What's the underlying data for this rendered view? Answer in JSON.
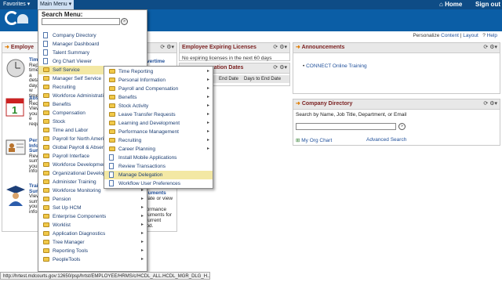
{
  "topbar": {
    "favorites": "Favorites",
    "main_menu": "Main Menu",
    "home": "Home",
    "sign_out": "Sign out"
  },
  "subbar": {
    "personalize": "Personalize",
    "content": "Content",
    "sep": "|",
    "layout": "Layout",
    "help": "Help"
  },
  "pagelets": {
    "employee": {
      "title": "Employe"
    },
    "time": {
      "title": "Time",
      "lines": [
        "Repo",
        "time a",
        "detail",
        "day, w",
        "time p"
      ]
    },
    "absence": {
      "title": "Abse",
      "lines": [
        "Requ",
        "View",
        "your e",
        "reque"
      ]
    },
    "personal": {
      "title": "Pers",
      "lines": [
        "Infor",
        "Sumi",
        "Revie",
        "summ",
        "your p",
        "inform"
      ]
    },
    "training": {
      "title": "Train",
      "lines": [
        "Sumi",
        "View",
        "summ",
        "your t",
        "inform"
      ]
    },
    "overtime": {
      "title": "vertime"
    },
    "documents": {
      "lines": [
        "cuments",
        "date or view",
        "r",
        "formance",
        "cuments for",
        "current",
        "iod."
      ]
    },
    "licenses": {
      "title": "Employee Expiring Licenses",
      "text": "No expiring licenses in the next 60 days"
    },
    "registration": {
      "title": "ration Dates",
      "cols": [
        "End Date",
        "Days to End Date"
      ]
    },
    "announcements": {
      "title": "Announcements",
      "item": "CONNECT Online Training"
    },
    "directory": {
      "title": "Company Directory",
      "prompt": "Search by Name, Job Title, Department, or Email",
      "my_org": "My Org Chart",
      "advanced": "Advanced Search"
    }
  },
  "main_menu": {
    "title": "Search Menu:",
    "items": [
      {
        "label": "Company Directory",
        "icon": "doc",
        "arrow": false
      },
      {
        "label": "Manager Dashboard",
        "icon": "doc",
        "arrow": false
      },
      {
        "label": "Talent Summary",
        "icon": "doc",
        "arrow": false
      },
      {
        "label": "Org Chart Viewer",
        "icon": "doc",
        "arrow": false
      },
      {
        "label": "Self Service",
        "icon": "folder",
        "arrow": true,
        "highlighted": true
      },
      {
        "label": "Manager Self Service",
        "icon": "folder",
        "arrow": true
      },
      {
        "label": "Recruiting",
        "icon": "folder",
        "arrow": true
      },
      {
        "label": "Workforce Administration",
        "icon": "folder",
        "arrow": true
      },
      {
        "label": "Benefits",
        "icon": "folder",
        "arrow": true
      },
      {
        "label": "Compensation",
        "icon": "folder",
        "arrow": true
      },
      {
        "label": "Stock",
        "icon": "folder",
        "arrow": true
      },
      {
        "label": "Time and Labor",
        "icon": "folder",
        "arrow": true
      },
      {
        "label": "Payroll for North America",
        "icon": "folder",
        "arrow": true
      },
      {
        "label": "Global Payroll & Absence Mgmt",
        "icon": "folder",
        "arrow": true
      },
      {
        "label": "Payroll Interface",
        "icon": "folder",
        "arrow": true
      },
      {
        "label": "Workforce Development",
        "icon": "folder",
        "arrow": true
      },
      {
        "label": "Organizational Development",
        "icon": "folder",
        "arrow": true
      },
      {
        "label": "Administer Training",
        "icon": "folder",
        "arrow": true
      },
      {
        "label": "Workforce Monitoring",
        "icon": "folder",
        "arrow": true
      },
      {
        "label": "Pension",
        "icon": "folder",
        "arrow": true
      },
      {
        "label": "Set Up HCM",
        "icon": "folder",
        "arrow": true
      },
      {
        "label": "Enterprise Components",
        "icon": "folder",
        "arrow": true
      },
      {
        "label": "Worklist",
        "icon": "folder",
        "arrow": true
      },
      {
        "label": "Application Diagnostics",
        "icon": "folder",
        "arrow": true
      },
      {
        "label": "Tree Manager",
        "icon": "folder",
        "arrow": true
      },
      {
        "label": "Reporting Tools",
        "icon": "folder",
        "arrow": true
      },
      {
        "label": "PeopleTools",
        "icon": "folder",
        "arrow": true
      }
    ]
  },
  "submenu": {
    "items": [
      {
        "label": "Time Reporting",
        "icon": "folder",
        "arrow": true
      },
      {
        "label": "Personal Information",
        "icon": "folder",
        "arrow": true
      },
      {
        "label": "Payroll and Compensation",
        "icon": "folder",
        "arrow": true
      },
      {
        "label": "Benefits",
        "icon": "folder",
        "arrow": true
      },
      {
        "label": "Stock Activity",
        "icon": "folder",
        "arrow": true
      },
      {
        "label": "Leave Transfer Requests",
        "icon": "folder",
        "arrow": true
      },
      {
        "label": "Learning and Development",
        "icon": "folder",
        "arrow": true
      },
      {
        "label": "Performance Management",
        "icon": "folder",
        "arrow": true
      },
      {
        "label": "Recruiting",
        "icon": "folder",
        "arrow": true
      },
      {
        "label": "Career Planning",
        "icon": "folder",
        "arrow": true
      },
      {
        "label": "Install Mobile Applications",
        "icon": "doc",
        "arrow": false
      },
      {
        "label": "Review Transactions",
        "icon": "doc",
        "arrow": false
      },
      {
        "label": "Manage Delegation",
        "icon": "doc",
        "arrow": false,
        "highlighted": true
      },
      {
        "label": "Workflow User Preferences",
        "icon": "doc",
        "arrow": false
      }
    ]
  },
  "status_url": "http://hrtest.mdcourts.gov:12650/psp/hrtst/EMPLOYEE/HRMS/c/HCDL_ALL.HCDL_MGR_DLG_H..."
}
